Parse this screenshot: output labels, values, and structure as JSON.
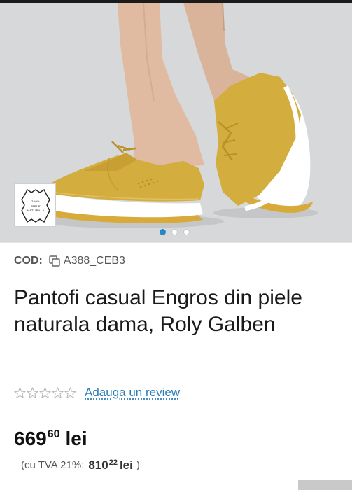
{
  "gallery": {
    "image_alt": "Pantofi casual galbeni din piele naturala",
    "badge": {
      "line1": "100%",
      "line2": "PIELE",
      "line3": "NATURALA"
    },
    "slides": [
      {
        "active": true
      },
      {
        "active": false
      },
      {
        "active": false
      }
    ]
  },
  "product": {
    "code_label": "COD:",
    "code_value": "A388_CEB3",
    "title": "Pantofi casual Engros din piele naturala dama, Roly Galben",
    "rating": {
      "stars_filled": 0,
      "stars_total": 5,
      "review_link": "Adauga un review"
    },
    "price": {
      "integer": "669",
      "decimals": "60",
      "currency": "lei"
    },
    "vat": {
      "label": "(cu TVA 21%:",
      "integer": "810",
      "decimals": "22",
      "currency": "lei",
      "close": ")"
    }
  },
  "colors": {
    "link": "#2a7db8",
    "active_dot": "#2487c8",
    "shoe": "#d3ad3e",
    "background": "#d6d8d9"
  }
}
